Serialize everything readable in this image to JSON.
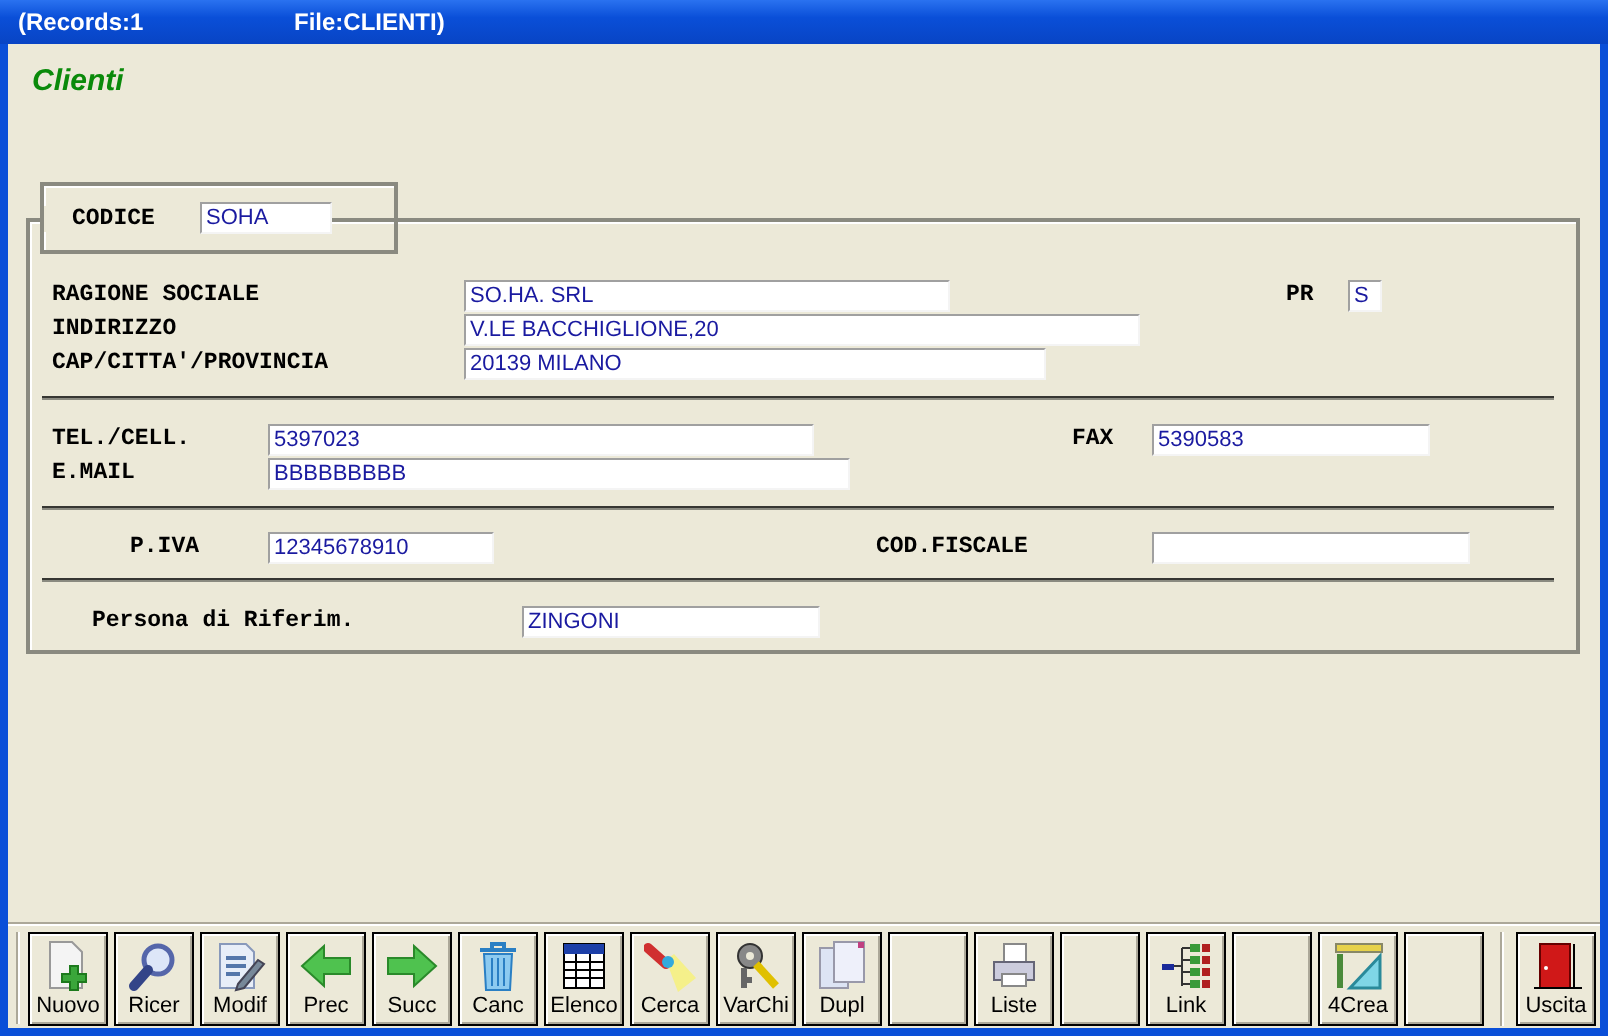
{
  "window": {
    "title_records": "(Records:1",
    "title_file": "File:CLIENTI)"
  },
  "form_title": "Clienti",
  "codice": {
    "label": "CODICE",
    "value": "SOHA"
  },
  "sections": [
    [
      [
        {
          "label": "RAGIONE SOCIALE",
          "value": "SO.HA. SRL"
        },
        {
          "label": "PR",
          "value": "S"
        }
      ],
      [
        {
          "label": "INDIRIZZO",
          "value": "V.LE BACCHIGLIONE,20"
        }
      ],
      [
        {
          "label": "CAP/CITTA'/PROVINCIA",
          "value": "20139 MILANO"
        }
      ]
    ],
    [
      [
        {
          "label": "TEL./CELL.",
          "value": "5397023"
        },
        {
          "label": "FAX",
          "value": "5390583"
        }
      ],
      [
        {
          "label": "E.MAIL",
          "value": "BBBBBBBBB"
        }
      ]
    ],
    [
      [
        {
          "label": "P.IVA",
          "value": "12345678910"
        },
        {
          "label": "COD.FISCALE"
        }
      ]
    ],
    [
      [
        {
          "label": "Persona di Riferim.",
          "value": "ZINGONI"
        }
      ]
    ]
  ],
  "toolbar": [
    {
      "kind": "new",
      "label": "Nuovo"
    },
    {
      "kind": "search",
      "label": "Ricer"
    },
    {
      "kind": "edit",
      "label": "Modif"
    },
    {
      "kind": "prev",
      "label": "Prec"
    },
    {
      "kind": "next",
      "label": "Succ"
    },
    {
      "kind": "delete",
      "label": "Canc"
    },
    {
      "kind": "list",
      "label": "Elenco"
    },
    {
      "kind": "find",
      "label": "Cerca"
    },
    {
      "kind": "keys",
      "label": "VarChi"
    },
    {
      "kind": "duplicate",
      "label": "Dupl"
    },
    {
      "kind": "blank"
    },
    {
      "kind": "print",
      "label": "Liste"
    },
    {
      "kind": "blank"
    },
    {
      "kind": "link",
      "label": "Link"
    },
    {
      "kind": "blank"
    },
    {
      "kind": "tool",
      "label": "4Crea"
    },
    {
      "kind": "blank"
    },
    {
      "kind": "exit",
      "label": "Uscita"
    }
  ]
}
